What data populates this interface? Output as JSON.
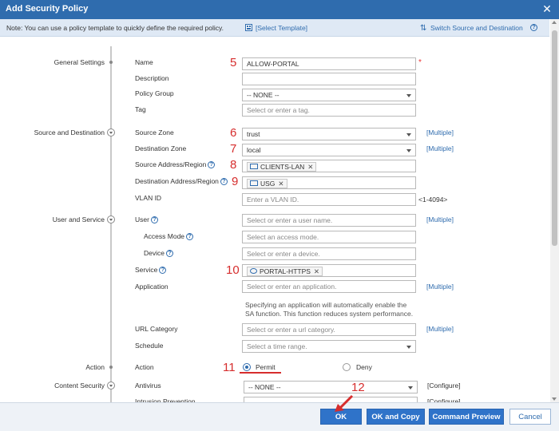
{
  "dialog": {
    "title": "Add Security Policy",
    "close": "✕"
  },
  "note": {
    "text": "Note: You can use a policy template to quickly define the required policy.",
    "template_link": "[Select Template]",
    "switch_link": "Switch Source and Destination"
  },
  "sections": {
    "general": "General Settings",
    "source_dest": "Source and Destination",
    "user_service": "User and Service",
    "action": "Action",
    "content_security": "Content Security"
  },
  "fields": {
    "name": {
      "label": "Name",
      "value": "ALLOW-PORTAL"
    },
    "description": {
      "label": "Description",
      "value": ""
    },
    "policy_group": {
      "label": "Policy Group",
      "value": "-- NONE --"
    },
    "tag": {
      "label": "Tag",
      "placeholder": "Select or enter a tag."
    },
    "source_zone": {
      "label": "Source Zone",
      "value": "trust",
      "multiple": "[Multiple]"
    },
    "destination_zone": {
      "label": "Destination Zone",
      "value": "local",
      "multiple": "[Multiple]"
    },
    "source_address": {
      "label": "Source Address/Region",
      "tag": "CLIENTS-LAN"
    },
    "destination_address": {
      "label": "Destination Address/Region",
      "tag": "USG"
    },
    "vlan_id": {
      "label": "VLAN ID",
      "placeholder": "Enter a VLAN ID.",
      "range": "<1-4094>"
    },
    "user": {
      "label": "User",
      "placeholder": "Select or enter a user name.",
      "multiple": "[Multiple]"
    },
    "access_mode": {
      "label": "Access Mode",
      "placeholder": "Select an access mode."
    },
    "device": {
      "label": "Device",
      "placeholder": "Select or enter a device."
    },
    "service": {
      "label": "Service",
      "tag": "PORTAL-HTTPS"
    },
    "application": {
      "label": "Application",
      "placeholder": "Select or enter an application.",
      "multiple": "[Multiple]"
    },
    "application_hint_1": "Specifying an application will automatically enable the",
    "application_hint_2": "SA function. This function reduces system performance.",
    "url_category": {
      "label": "URL Category",
      "placeholder": "Select or enter a url category.",
      "multiple": "[Multiple]"
    },
    "schedule": {
      "label": "Schedule",
      "placeholder": "Select a time range."
    },
    "action": {
      "label": "Action",
      "permit": "Permit",
      "deny": "Deny",
      "selected": "Permit"
    },
    "antivirus": {
      "label": "Antivirus",
      "value": "-- NONE --",
      "configure": "[Configure]"
    },
    "intrusion_prevention": {
      "label": "Intrusion Prevention",
      "configure": "[Configure]"
    }
  },
  "annotations": {
    "n5": "5",
    "n6": "6",
    "n7": "7",
    "n8": "8",
    "n9": "9",
    "n10": "10",
    "n11": "11",
    "n12": "12"
  },
  "buttons": {
    "ok": "OK",
    "ok_copy": "OK and Copy",
    "preview": "Command Preview",
    "cancel": "Cancel"
  },
  "colors": {
    "title_bar": "#2f6cae",
    "accent": "#2f73c9",
    "annotation": "#d62d2d"
  }
}
